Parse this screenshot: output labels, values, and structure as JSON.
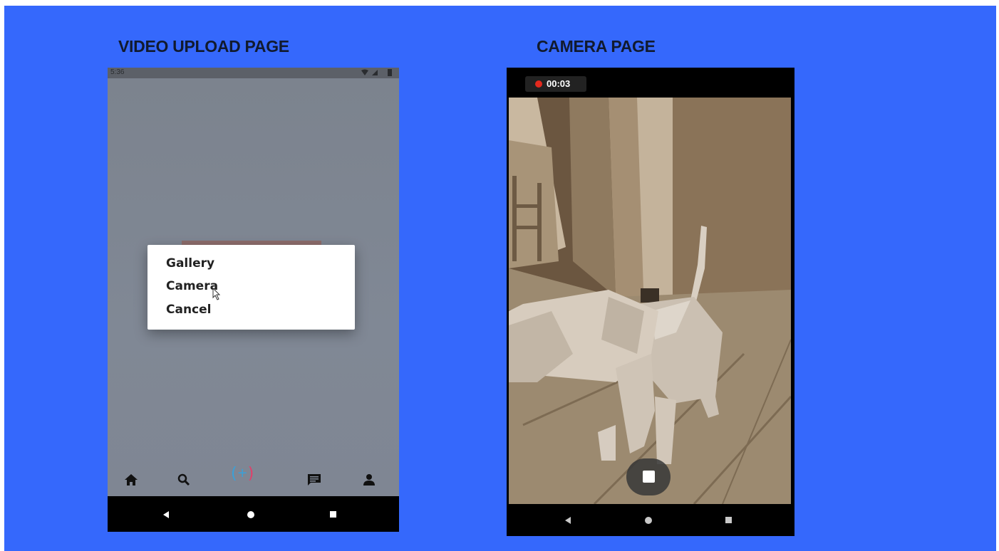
{
  "slide": {
    "left_title": "VIDEO UPLOAD PAGE",
    "right_title": "CAMERA PAGE",
    "background": "#3568fc"
  },
  "upload_screen": {
    "status_time": "5:36",
    "dialog": {
      "items": [
        "Gallery",
        "Camera",
        "Cancel"
      ]
    },
    "bottom_nav": {
      "items": [
        "home-icon",
        "search-icon",
        "add-video-icon",
        "chat-icon",
        "profile-icon"
      ],
      "add_symbol": "+"
    },
    "system_nav": [
      "back-icon",
      "home-circle-icon",
      "recents-icon"
    ]
  },
  "camera_screen": {
    "recording_time": "00:03",
    "record_indicator_color": "#e3291d",
    "system_nav": [
      "back-icon",
      "home-circle-icon",
      "recents-icon"
    ]
  }
}
